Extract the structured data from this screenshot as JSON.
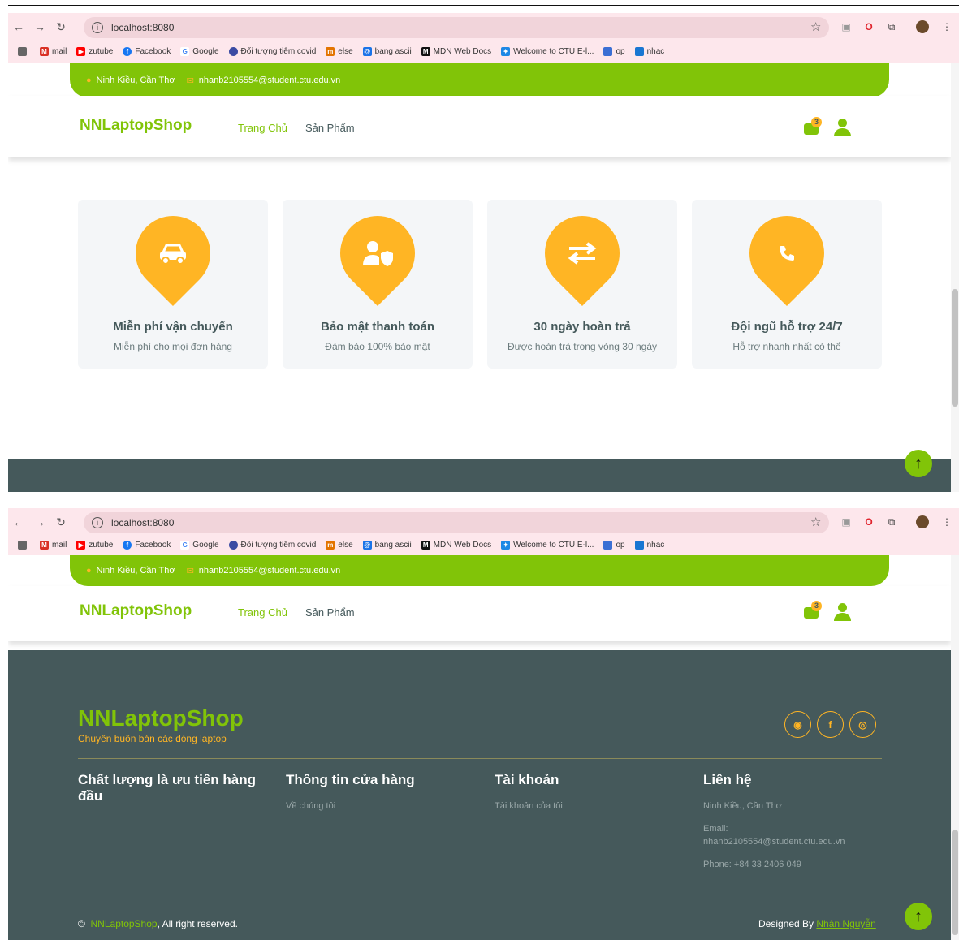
{
  "browser": {
    "url": "localhost:8080",
    "bookmarks": [
      {
        "label": "mail",
        "icon": "gmail-icon",
        "color": "#d93025"
      },
      {
        "label": "zutube",
        "icon": "youtube-icon",
        "color": "#ff0000"
      },
      {
        "label": "Facebook",
        "icon": "facebook-icon",
        "color": "#1877f2"
      },
      {
        "label": "Google",
        "icon": "google-icon",
        "color": "#4285f4"
      },
      {
        "label": "Đối tượng tiêm covid",
        "icon": "covid-icon",
        "color": "#3b4ba3"
      },
      {
        "label": "else",
        "icon": "else-icon",
        "color": "#e37400"
      },
      {
        "label": "bang ascii",
        "icon": "ascii-icon",
        "color": "#1a73e8"
      },
      {
        "label": "MDN Web Docs",
        "icon": "mdn-icon",
        "color": "#111111"
      },
      {
        "label": "Welcome to CTU E-l...",
        "icon": "ctu-icon",
        "color": "#1e88e5"
      },
      {
        "label": "op",
        "icon": "op-icon",
        "color": "#3b6fd4"
      },
      {
        "label": "nhac",
        "icon": "nhac-icon",
        "color": "#1976d2"
      }
    ]
  },
  "topbar": {
    "address": "Ninh Kiều, Cần Thơ",
    "email": "nhanb2105554@student.ctu.edu.vn"
  },
  "navbar": {
    "brand": "NNLaptopShop",
    "menu": [
      "Trang Chủ",
      "Sản Phẩm"
    ],
    "cart_count": "3"
  },
  "features": [
    {
      "title": "Miễn phí vận chuyển",
      "desc": "Miễn phí cho mọi đơn hàng",
      "icon": "car-icon"
    },
    {
      "title": "Bảo mật thanh toán",
      "desc": "Đảm bảo 100% bảo mật",
      "icon": "user-shield-icon"
    },
    {
      "title": "30 ngày hoàn trả",
      "desc": "Được hoàn trả trong vòng 30 ngày",
      "icon": "exchange-icon"
    },
    {
      "title": "Đội ngũ hỗ trợ 24/7",
      "desc": "Hỗ trợ nhanh nhất có thể",
      "icon": "phone-icon"
    }
  ],
  "footer": {
    "brand": "NNLaptopShop",
    "tagline": "Chuyên buôn bán các dòng laptop",
    "col1_title": "Chất lượng là ưu tiên hàng đầu",
    "col2_title": "Thông tin cửa hàng",
    "col2_link": "Về chúng tôi",
    "col3_title": "Tài khoản",
    "col3_link": "Tài khoản của tôi",
    "col4_title": "Liên hệ",
    "col4_address": "Ninh Kiều, Cần Thơ",
    "col4_email_label": "Email:",
    "col4_email": "nhanb2105554@student.ctu.edu.vn",
    "col4_phone": "Phone: +84 33 2406 049",
    "copyright_brand": "NNLaptopShop",
    "copyright_rest": ", All right reserved.",
    "designed_by": "Designed By",
    "designer": "Nhân Nguyễn"
  },
  "colors": {
    "primary": "#81c408",
    "secondary": "#ffb524",
    "footer": "#45595b"
  }
}
